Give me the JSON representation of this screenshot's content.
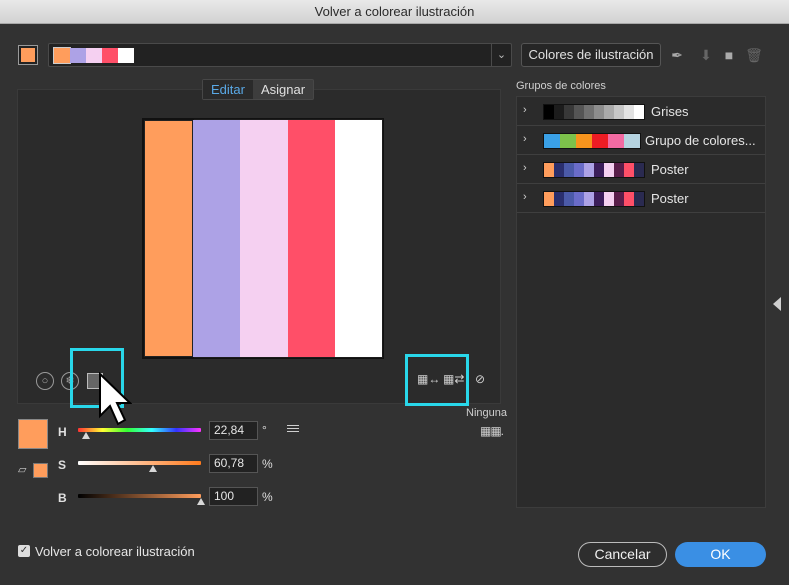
{
  "window": {
    "title": "Volver a colorear ilustración"
  },
  "current_color": "#ff9d5c",
  "strip_colors": [
    "#ff9d5c",
    "#ada2e6",
    "#f5d0f1",
    "#ff4f68",
    "#ffffff"
  ],
  "library_button": {
    "label": "Colores de ilustración"
  },
  "tabs": [
    {
      "label": "Editar",
      "active": true
    },
    {
      "label": "Asignar",
      "active": false
    }
  ],
  "harmony_bars": [
    "#ff9d5c",
    "#ada2e6",
    "#f5d0f1",
    "#ff4f68",
    "#ffffff"
  ],
  "ninguna_label": "Ninguna",
  "sliders": {
    "h": {
      "label": "H",
      "value": "22,84",
      "unit": "°",
      "fraction": 0.063
    },
    "s": {
      "label": "S",
      "value": "60,78",
      "unit": "%",
      "fraction": 0.608
    },
    "b": {
      "label": "B",
      "value": "100",
      "unit": "%",
      "fraction": 1.0
    }
  },
  "color_groups": {
    "title": "Grupos de colores",
    "groups": [
      {
        "name": "Grises",
        "chips": [
          "#000000",
          "#1c1c1c",
          "#383838",
          "#555555",
          "#717171",
          "#8d8d8d",
          "#aaaaaa",
          "#c6c6c6",
          "#e2e2e2",
          "#ffffff"
        ]
      },
      {
        "name": "Grupo de colores...",
        "chips": [
          "#3aa0e6",
          "#7dc24b",
          "#f7941d",
          "#ed1c24",
          "#f26aa2",
          "#b5d3e0"
        ]
      },
      {
        "name": "Poster",
        "chips": [
          "#ff9d5c",
          "#2a2f6e",
          "#4b5aa8",
          "#6a6cc8",
          "#ada2e6",
          "#3b1d5a",
          "#f5d0f1",
          "#5a1d4a",
          "#ff4f68",
          "#2a2a50"
        ]
      },
      {
        "name": "Poster",
        "chips": [
          "#ff9d5c",
          "#2a2f6e",
          "#4b5aa8",
          "#6a6cc8",
          "#ada2e6",
          "#3b1d5a",
          "#f5d0f1",
          "#5a1d4a",
          "#ff4f68",
          "#2a2a50"
        ]
      }
    ]
  },
  "recolor_checkbox": {
    "label": "Volver a colorear ilustración",
    "checked": true
  },
  "buttons": {
    "cancel": "Cancelar",
    "ok": "OK"
  },
  "colors": {
    "accent": "#29d7ea",
    "primary_button": "#3a8fe4",
    "active_tab": "#5aa9e6"
  }
}
